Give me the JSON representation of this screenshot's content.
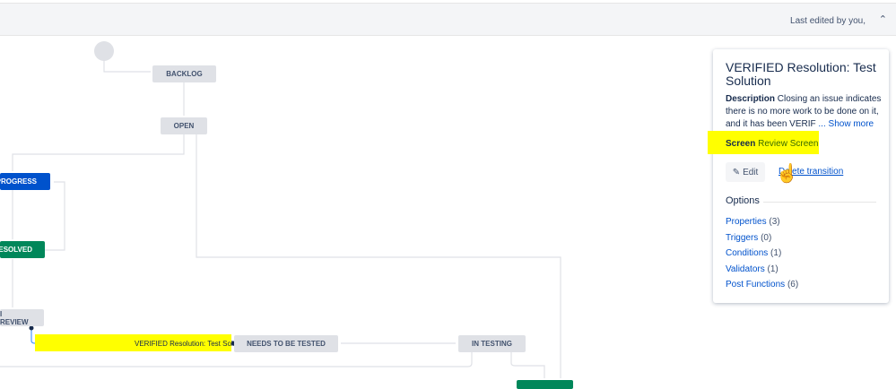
{
  "header": {
    "last_edited": "Last edited by you,",
    "collapse_icon": "double-chevron-up-icon"
  },
  "workflow": {
    "nodes": {
      "backlog": "BACKLOG",
      "open": "OPEN",
      "in_progress": "PROGRESS",
      "resolved": "ESOLVED",
      "in_review": "I REVIEW",
      "needs_tested": "NEEDS TO BE TESTED",
      "in_testing": "IN TESTING"
    },
    "selected_transition": "VERIFIED Resolution: Test Sol..."
  },
  "panel": {
    "title": "VERIFIED Resolution: Test Solution",
    "description_label": "Description",
    "description_text": "Closing an issue indicates there is no more work to be done on it, and it has been VERIF",
    "show_more": "... Show more",
    "screen_label": "Screen",
    "screen_value": "Review Screen",
    "edit_label": "Edit",
    "delete_label": "Delete transition",
    "options_heading": "Options",
    "options": [
      {
        "label": "Properties",
        "count": "(3)"
      },
      {
        "label": "Triggers",
        "count": "(0)"
      },
      {
        "label": "Conditions",
        "count": "(1)"
      },
      {
        "label": "Validators",
        "count": "(1)"
      },
      {
        "label": "Post Functions",
        "count": "(6)"
      }
    ]
  }
}
